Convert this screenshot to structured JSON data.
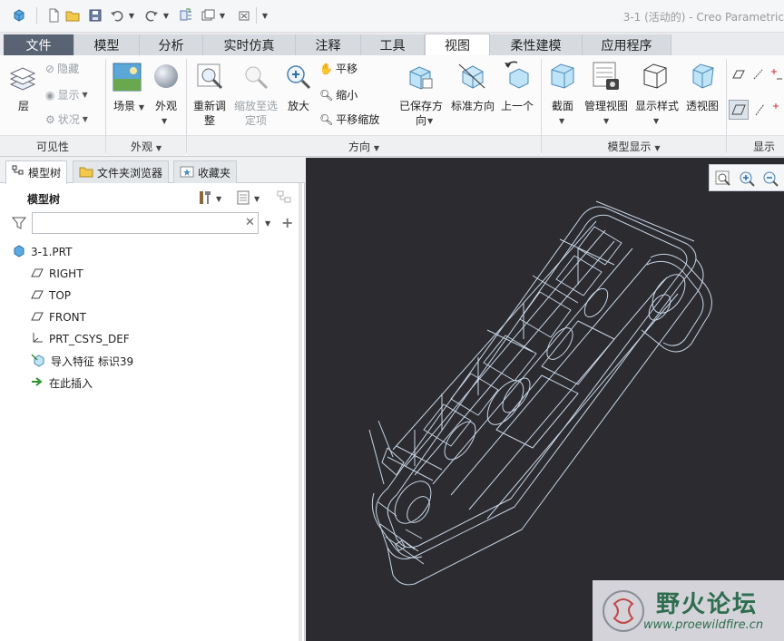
{
  "window": {
    "title": "3-1 (活动的) - Creo Parametric"
  },
  "quick_access": {
    "icons": [
      "part-cube-icon",
      "new-file-icon",
      "open-folder-icon",
      "save-icon",
      "undo-icon",
      "redo-icon",
      "regenerate-icon",
      "windows-icon",
      "close-window-icon",
      "customize-icon"
    ]
  },
  "ribbon": {
    "tabs": [
      {
        "label": "文件",
        "state": "file"
      },
      {
        "label": "模型",
        "state": "normal"
      },
      {
        "label": "分析",
        "state": "normal"
      },
      {
        "label": "实时仿真",
        "state": "normal"
      },
      {
        "label": "注释",
        "state": "normal"
      },
      {
        "label": "工具",
        "state": "normal"
      },
      {
        "label": "视图",
        "state": "active"
      },
      {
        "label": "柔性建模",
        "state": "normal"
      },
      {
        "label": "应用程序",
        "state": "normal"
      }
    ],
    "groups": {
      "visibility": {
        "label": "可见性",
        "layer": "层",
        "hide": "隐藏",
        "show": "显示",
        "status": "状况"
      },
      "appearance": {
        "label": "外观",
        "scene": "场景",
        "appearance": "外观"
      },
      "orientation": {
        "label": "方向",
        "refit": "重新调整",
        "zoom_to_selected": "缩放至选定项",
        "zoom_in": "放大",
        "pan": "平移",
        "zoom_out": "缩小",
        "pan_zoom": "平移缩放",
        "saved_orientations": "已保存方向",
        "standard_orientation": "标准方向",
        "previous": "上一个"
      },
      "model_display": {
        "label": "模型显示",
        "section": "截面",
        "manage_views": "管理视图",
        "display_style": "显示样式",
        "perspective": "透视图"
      },
      "show": {
        "label": "显示"
      }
    }
  },
  "left_panel": {
    "tabs": [
      {
        "label": "模型树",
        "active": true
      },
      {
        "label": "文件夹浏览器",
        "active": false
      },
      {
        "label": "收藏夹",
        "active": false
      }
    ],
    "tree_header": "模型树",
    "filter": {
      "value": "",
      "placeholder": ""
    },
    "tree": [
      {
        "label": "3-1.PRT",
        "icon": "part-icon",
        "indent": 0
      },
      {
        "label": "RIGHT",
        "icon": "datum-plane-icon",
        "indent": 1
      },
      {
        "label": "TOP",
        "icon": "datum-plane-icon",
        "indent": 1
      },
      {
        "label": "FRONT",
        "icon": "datum-plane-icon",
        "indent": 1
      },
      {
        "label": "PRT_CSYS_DEF",
        "icon": "csys-icon",
        "indent": 1
      },
      {
        "label": "导入特征 标识39",
        "icon": "import-feature-icon",
        "indent": 1
      },
      {
        "label": "在此插入",
        "icon": "insert-here-arrow-icon",
        "indent": 1
      }
    ]
  },
  "graphics": {
    "background": "#2b2b30",
    "wire_color": "#c9d6e6",
    "toolbar_icons": [
      "refit-icon",
      "zoom-in-icon",
      "zoom-out-icon"
    ]
  },
  "watermark": {
    "title": "野火论坛",
    "url": "www.proewildfire.cn"
  }
}
